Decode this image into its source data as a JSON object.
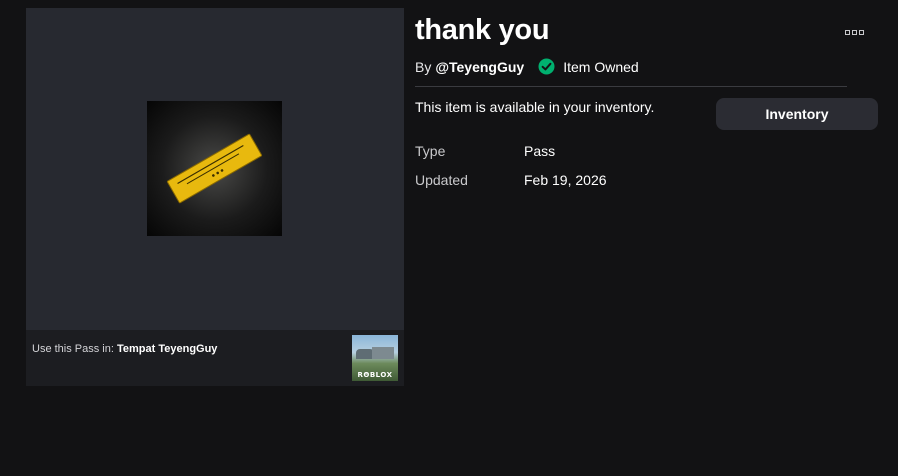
{
  "item": {
    "title": "thank you",
    "by_prefix": "By",
    "creator": "@TeyengGuy",
    "owned_status": "Item Owned",
    "availability": "This item is available in your inventory.",
    "inventory_button": "Inventory",
    "details": [
      {
        "label": "Type",
        "value": "Pass"
      },
      {
        "label": "Updated",
        "value": "Feb 19, 2026"
      }
    ]
  },
  "media": {
    "use_prefix": "Use this Pass in:",
    "place_name": "Tempat TeyengGuy",
    "place_logo": "RΘBLOX"
  },
  "colors": {
    "background": "#121214",
    "panel": "#272930",
    "owned_green": "#00b06f",
    "pass_gold": "#e8b90e",
    "button": "#2b2c33"
  },
  "icons": [
    "pass-ticket-icon",
    "owned-check-icon",
    "more-options-icon"
  ]
}
